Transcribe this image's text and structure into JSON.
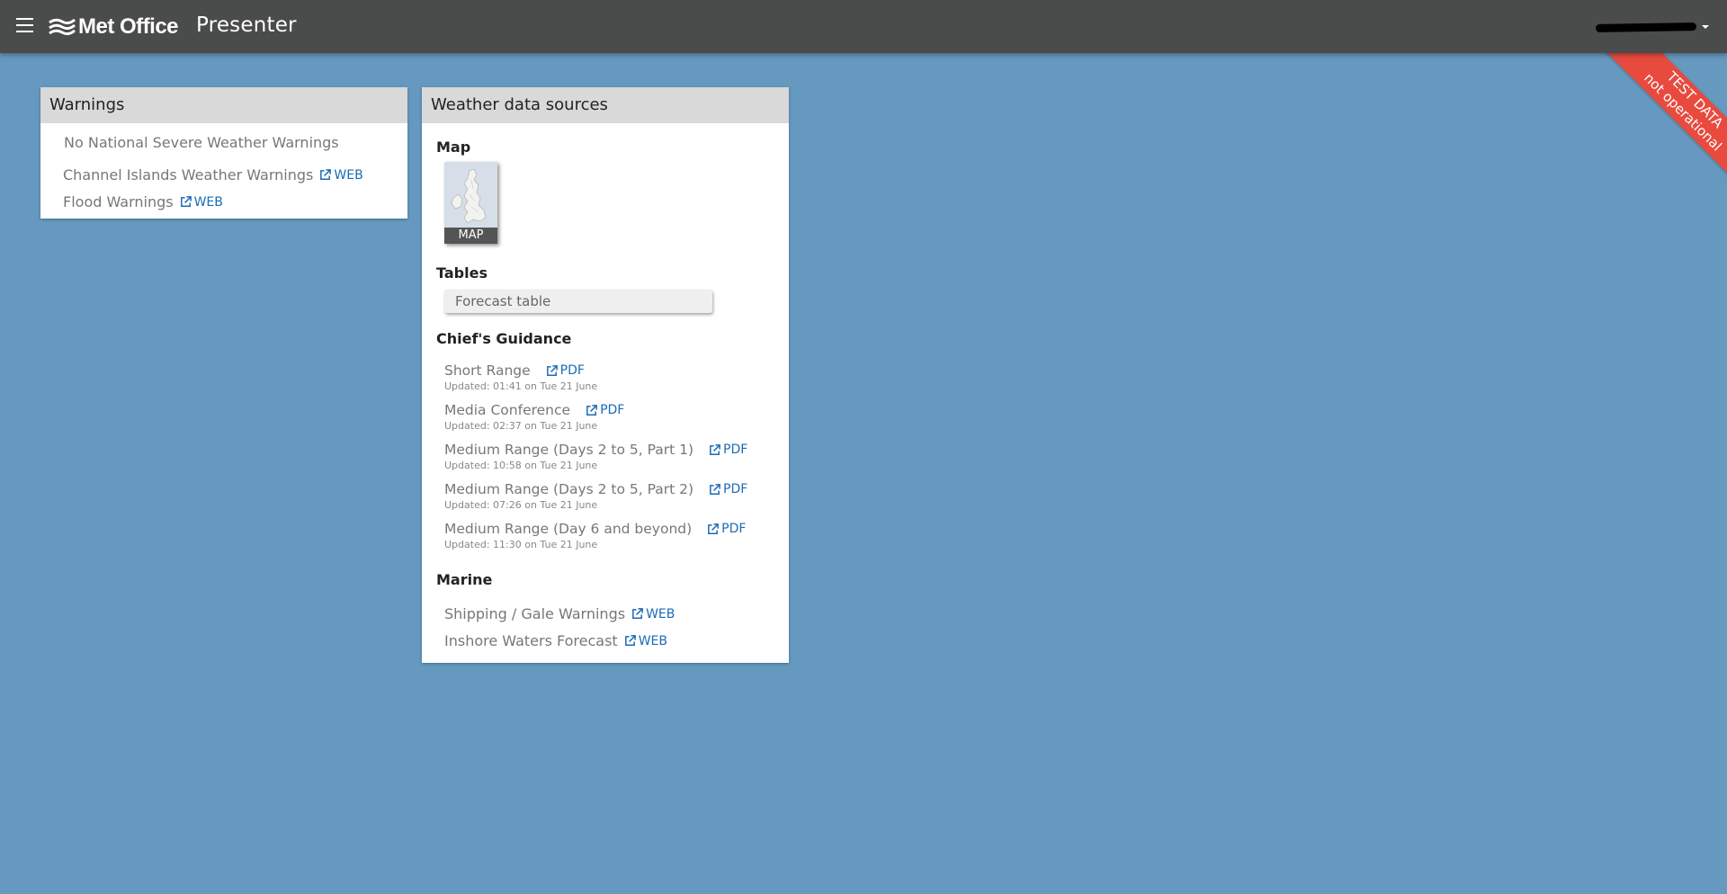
{
  "header": {
    "brand": "Met Office",
    "app_name": "Presenter"
  },
  "ribbon": {
    "line1": "TEST DATA",
    "line2": "not operational",
    "color": "#e84a3e"
  },
  "warnings": {
    "title": "Warnings",
    "national": "No National Severe Weather Warnings",
    "channel_islands": {
      "label": "Channel Islands Weather Warnings",
      "link": "WEB"
    },
    "flood": {
      "label": "Flood Warnings",
      "link": "WEB"
    }
  },
  "sources": {
    "title": "Weather data sources",
    "map": {
      "heading": "Map",
      "thumb_label": "MAP"
    },
    "tables": {
      "heading": "Tables",
      "forecast_table": "Forecast table"
    },
    "guidance": {
      "heading": "Chief's Guidance",
      "items": [
        {
          "title": "Short Range",
          "link": "PDF",
          "updated": "Updated: 01:41 on Tue 21 June"
        },
        {
          "title": "Media Conference",
          "link": "PDF",
          "updated": "Updated: 02:37 on Tue 21 June"
        },
        {
          "title": "Medium Range (Days 2 to 5, Part 1)",
          "link": "PDF",
          "updated": "Updated: 10:58 on Tue 21 June"
        },
        {
          "title": "Medium Range (Days 2 to 5, Part 2)",
          "link": "PDF",
          "updated": "Updated: 07:26 on Tue 21 June"
        },
        {
          "title": "Medium Range (Day 6 and beyond)",
          "link": "PDF",
          "updated": "Updated: 11:30 on Tue 21 June"
        }
      ]
    },
    "marine": {
      "heading": "Marine",
      "shipping": {
        "label": "Shipping / Gale Warnings",
        "link": "WEB"
      },
      "inshore": {
        "label": "Inshore Waters Forecast",
        "link": "WEB"
      }
    }
  },
  "colors": {
    "background": "#6699bf",
    "topbar": "#4a4b4b",
    "link": "#1c6bb5",
    "panel_header": "#d9d9d9"
  }
}
